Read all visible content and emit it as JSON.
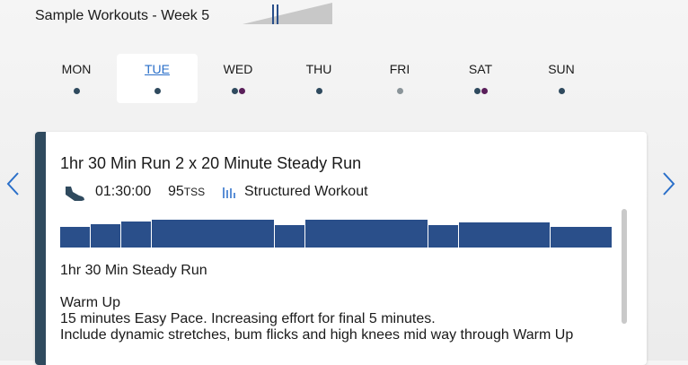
{
  "header": {
    "title": "Sample Workouts - Week 5"
  },
  "days": [
    {
      "label": "MON",
      "active": false,
      "dots": [
        "#2f4a5e"
      ]
    },
    {
      "label": "TUE",
      "active": true,
      "dots": [
        "#2f4a5e"
      ]
    },
    {
      "label": "WED",
      "active": false,
      "dots": [
        "#2f4a5e",
        "#5a1f5a"
      ]
    },
    {
      "label": "THU",
      "active": false,
      "dots": [
        "#2f4a5e"
      ]
    },
    {
      "label": "FRI",
      "active": false,
      "dots": [
        "#8a9499"
      ]
    },
    {
      "label": "SAT",
      "active": false,
      "dots": [
        "#2f4a5e",
        "#5a1f5a"
      ]
    },
    {
      "label": "SUN",
      "active": false,
      "dots": [
        "#2f4a5e"
      ]
    }
  ],
  "nav": {
    "prev_icon": "chevron-left-icon",
    "next_icon": "chevron-right-icon",
    "color": "#2a6fc9"
  },
  "workout": {
    "title": "1hr 30 Min Run 2 x 20 Minute Steady Run",
    "sport_icon": "running-shoe-icon",
    "duration": "01:30:00",
    "tss_value": "95",
    "tss_unit": "TSS",
    "type_icon": "bar-chart-icon",
    "type_label": "Structured Workout",
    "accent_color": "#2f4a5e",
    "chart_color": "#2a4f8a",
    "description_title": "1hr 30 Min Steady Run",
    "warmup_heading": "Warm Up",
    "warmup_lines": [
      "15 minutes Easy Pace. Increasing effort for final 5 minutes.",
      "Include dynamic stretches, bum flicks and high knees mid way through Warm Up"
    ]
  }
}
